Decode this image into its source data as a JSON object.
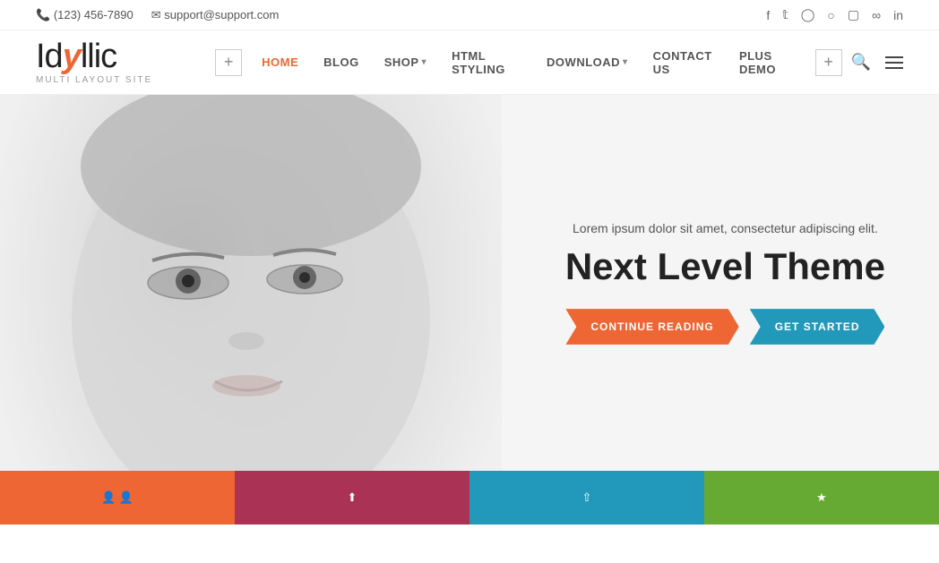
{
  "topbar": {
    "phone": "(123) 456-7890",
    "email": "support@support.com",
    "social": [
      "f",
      "t",
      "p",
      "b",
      "i",
      "s",
      "in"
    ]
  },
  "header": {
    "logo_part1": "Id",
    "logo_y": "y",
    "logo_part2": "llic",
    "logo_sub": "Multi Layout Site",
    "add_btn1": "+",
    "add_btn2": "+",
    "nav": [
      {
        "label": "HOME",
        "active": true,
        "has_dropdown": false
      },
      {
        "label": "BLOG",
        "active": false,
        "has_dropdown": false
      },
      {
        "label": "SHOP",
        "active": false,
        "has_dropdown": true
      },
      {
        "label": "HTML STYLING",
        "active": false,
        "has_dropdown": false
      },
      {
        "label": "DOWNLOAD",
        "active": false,
        "has_dropdown": true
      },
      {
        "label": "CONTACT US",
        "active": false,
        "has_dropdown": false
      },
      {
        "label": "PLUS DEMO",
        "active": false,
        "has_dropdown": false
      }
    ]
  },
  "hero": {
    "subtitle": "Lorem ipsum dolor sit amet, consectetur adipiscing elit.",
    "title": "Next Level Theme",
    "btn_continue": "CONTINUE READING",
    "btn_started": "GET STARTED"
  },
  "bottom_blocks": [
    {
      "color": "red",
      "icon": "person"
    },
    {
      "color": "purple",
      "icon": "upload"
    },
    {
      "color": "teal",
      "icon": "share"
    },
    {
      "color": "green",
      "icon": "star"
    }
  ]
}
